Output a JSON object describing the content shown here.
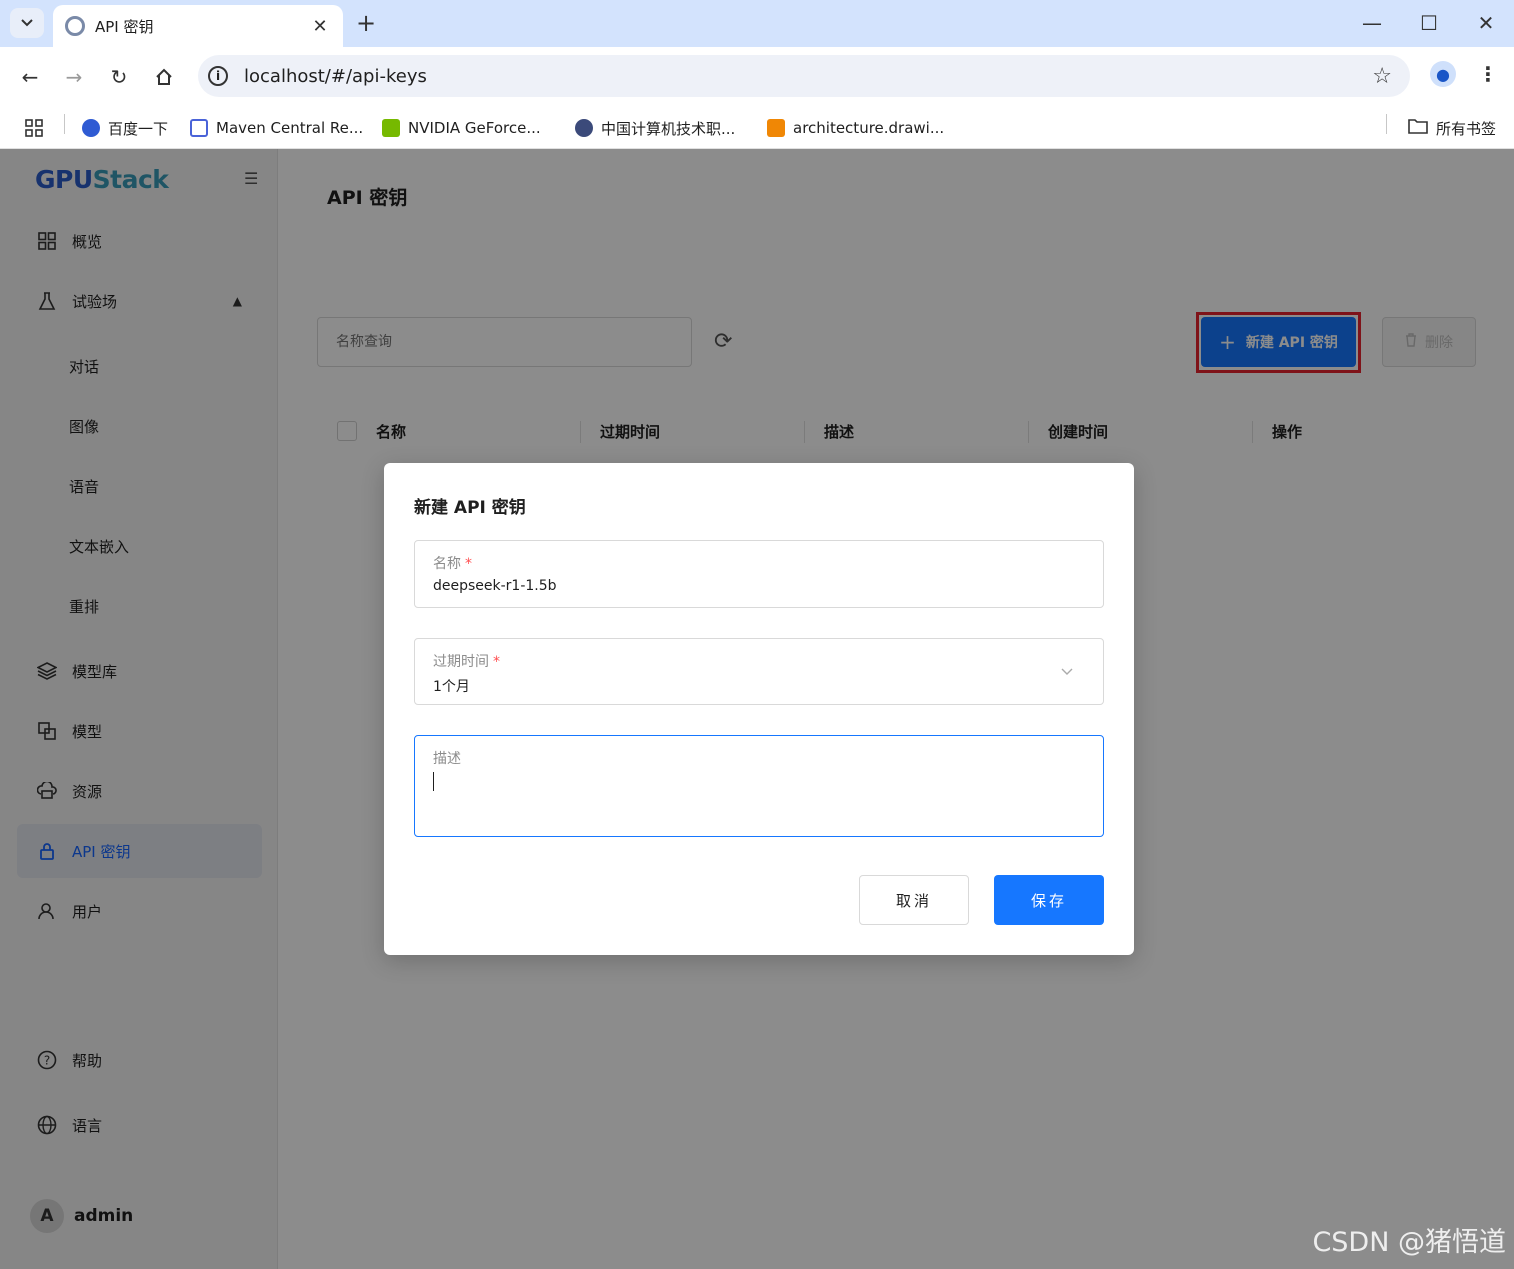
{
  "browser": {
    "tab_title": "API 密钥",
    "url": "localhost/#/api-keys",
    "bookmarks": [
      "百度一下",
      "Maven Central Re...",
      "NVIDIA GeForce...",
      "中国计算机技术职...",
      "architecture.drawi..."
    ],
    "all_bookmarks": "所有书签"
  },
  "sidebar": {
    "logo_main": "GPU",
    "logo_accent": "Stack",
    "items": {
      "overview": "概览",
      "playground": "试验场",
      "chat": "对话",
      "image": "图像",
      "audio": "语音",
      "embedding": "文本嵌入",
      "rerank": "重排",
      "catalog": "模型库",
      "models": "模型",
      "resources": "资源",
      "api_keys": "API 密钥",
      "users": "用户",
      "help": "帮助",
      "language": "语言"
    },
    "user": {
      "avatar_letter": "A",
      "name": "admin"
    }
  },
  "page": {
    "title": "API 密钥",
    "search_placeholder": "名称查询",
    "new_button": "新建 API 密钥",
    "delete_button": "删除",
    "columns": [
      "名称",
      "过期时间",
      "描述",
      "创建时间",
      "操作"
    ]
  },
  "modal": {
    "title": "新建 API 密钥",
    "name_label": "名称",
    "name_value": "deepseek-r1-1.5b",
    "expiry_label": "过期时间",
    "expiry_value": "1个月",
    "description_label": "描述",
    "required_mark": "*",
    "cancel": "取消",
    "save": "保存"
  },
  "watermark": "CSDN @猪悟道",
  "colors": {
    "primary": "#1677ff",
    "highlight": "#e8242f",
    "required": "#ff4d4f"
  }
}
